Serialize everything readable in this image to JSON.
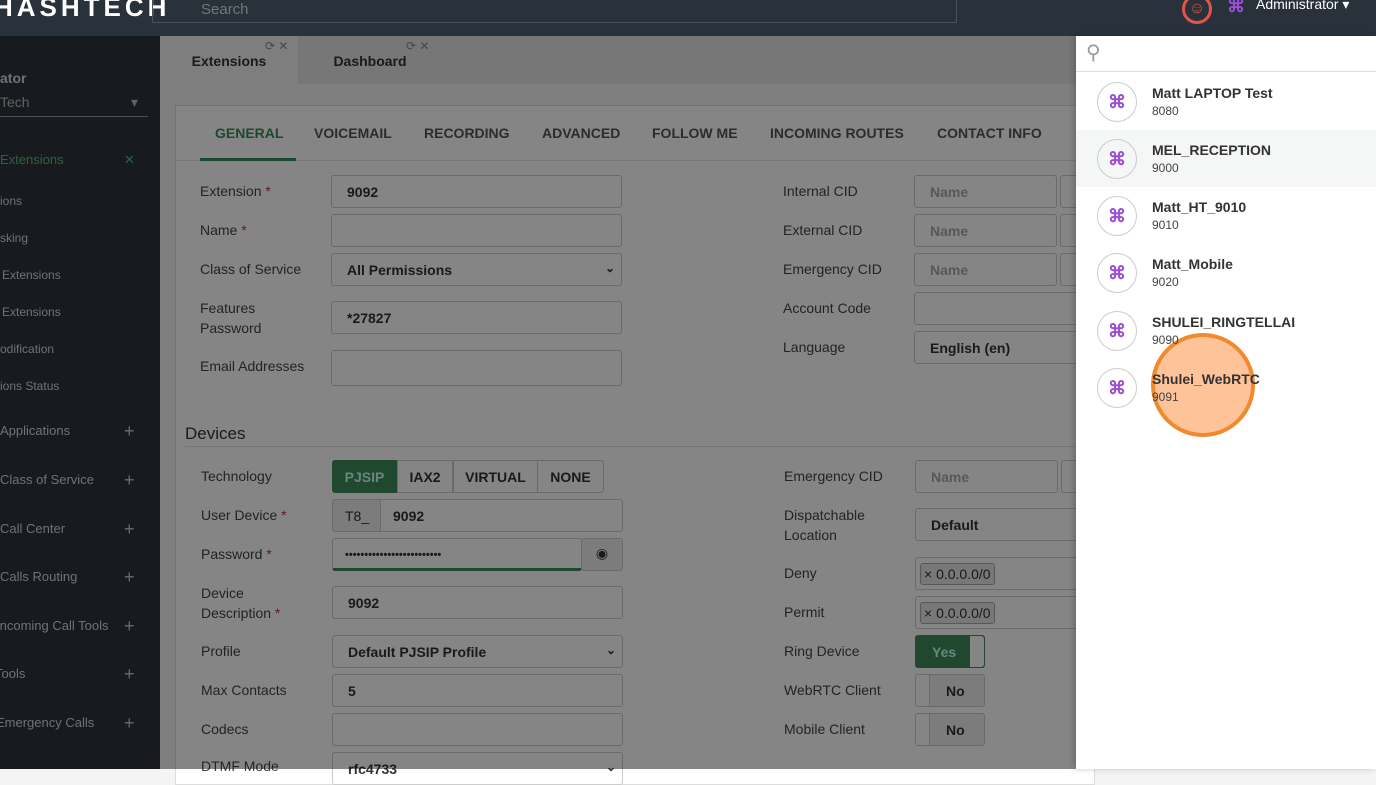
{
  "header": {
    "logo": "HASHTECH",
    "search_placeholder": "Search",
    "user": "Administrator"
  },
  "sidebar": {
    "role": "ator",
    "tenant": "Tech",
    "active": "Extensions",
    "items": [
      "ions",
      "sking",
      "Extensions",
      "Extensions",
      "odification",
      "ions Status"
    ],
    "groups": [
      "Applications",
      "Class of Service",
      "Call Center",
      "Calls Routing",
      "Incoming Call Tools",
      "Tools",
      "Emergency Calls"
    ]
  },
  "page_tabs": [
    "Extensions",
    "Dashboard"
  ],
  "form_tabs": [
    "GENERAL",
    "VOICEMAIL",
    "RECORDING",
    "ADVANCED",
    "FOLLOW ME",
    "INCOMING ROUTES",
    "CONTACT INFO"
  ],
  "general": {
    "extension": {
      "label": "Extension",
      "value": "9092"
    },
    "name": {
      "label": "Name",
      "value": ""
    },
    "cos": {
      "label": "Class of Service",
      "value": "All Permissions"
    },
    "features_password": {
      "label": "Features Password",
      "value": "*27827"
    },
    "email": {
      "label": "Email Addresses",
      "value": ""
    },
    "internal_cid": {
      "label": "Internal CID",
      "placeholder": "Name"
    },
    "external_cid": {
      "label": "External CID",
      "placeholder": "Name"
    },
    "emergency_cid": {
      "label": "Emergency CID",
      "placeholder": "Name"
    },
    "account_code": {
      "label": "Account Code",
      "value": ""
    },
    "language": {
      "label": "Language",
      "value": "English (en)"
    }
  },
  "devices": {
    "title": "Devices",
    "technology": {
      "label": "Technology",
      "options": [
        "PJSIP",
        "IAX2",
        "VIRTUAL",
        "NONE"
      ],
      "selected": "PJSIP"
    },
    "user_device": {
      "label": "User Device",
      "prefix": "T8_",
      "value": "9092"
    },
    "password": {
      "label": "Password",
      "value": "•••••••••••••••••••••••••"
    },
    "description": {
      "label": "Device Description",
      "value": "9092"
    },
    "profile": {
      "label": "Profile",
      "value": "Default PJSIP Profile"
    },
    "max_contacts": {
      "label": "Max Contacts",
      "value": "5"
    },
    "codecs": {
      "label": "Codecs",
      "value": ""
    },
    "dtmf": {
      "label": "DTMF Mode",
      "value": "rfc4733"
    },
    "emergency_cid": {
      "label": "Emergency CID",
      "placeholder": "Name"
    },
    "dispatchable": {
      "label": "Dispatchable Location",
      "value": "Default"
    },
    "deny": {
      "label": "Deny",
      "value": "0.0.0.0/0"
    },
    "permit": {
      "label": "Permit",
      "value": "0.0.0.0/0"
    },
    "ring_device": {
      "label": "Ring Device",
      "value": "Yes"
    },
    "webrtc": {
      "label": "WebRTC Client",
      "value": "No"
    },
    "mobile": {
      "label": "Mobile Client",
      "value": "No"
    }
  },
  "panel": {
    "items": [
      {
        "name": "Matt LAPTOP Test",
        "number": "8080"
      },
      {
        "name": "MEL_RECEPTION",
        "number": "9000"
      },
      {
        "name": "Matt_HT_9010",
        "number": "9010"
      },
      {
        "name": "Matt_Mobile",
        "number": "9020"
      },
      {
        "name": "SHULEI_RINGTELLAI",
        "number": "9090"
      },
      {
        "name": "Shulei_WebRTC",
        "number": "9091"
      }
    ]
  },
  "colors": {
    "accent": "#3f8a5a",
    "header": "#29313b",
    "avatar_icon": "#9b4fd6",
    "click": "#f08a2c"
  }
}
